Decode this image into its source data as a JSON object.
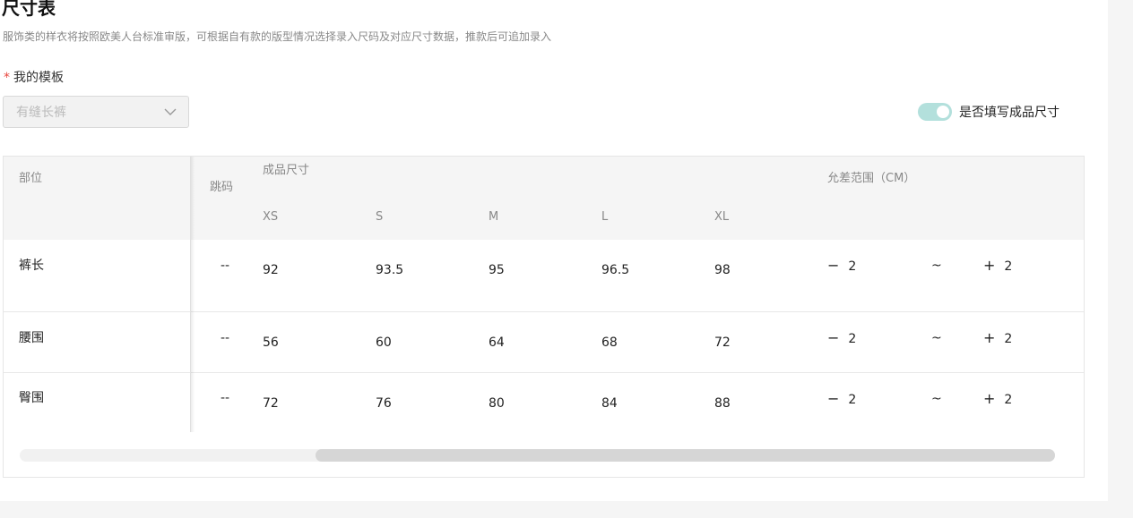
{
  "header": {
    "title": "尺寸表",
    "description": "服饰类的样衣将按照欧美人台标准审版，可根据自有款的版型情况选择录入尺码及对应尺寸数据，推款后可追加录入"
  },
  "template": {
    "required_mark": "*",
    "label": "我的模板",
    "selected": "有缝长裤"
  },
  "toggle": {
    "label": "是否填写成品尺寸",
    "on": true
  },
  "table": {
    "headers": {
      "part": "部位",
      "jump": "跳码",
      "finished_size": "成品尺寸",
      "tolerance": "允差范围（CM）",
      "sizes": [
        "XS",
        "S",
        "M",
        "L",
        "XL"
      ]
    },
    "rows": [
      {
        "part": "裤长",
        "jump": "--",
        "values": [
          "92",
          "93.5",
          "95",
          "96.5",
          "98"
        ],
        "minus": "2",
        "sep": "~",
        "plus": "2"
      },
      {
        "part": "腰围",
        "jump": "--",
        "values": [
          "56",
          "60",
          "64",
          "68",
          "72"
        ],
        "minus": "2",
        "sep": "~",
        "plus": "2"
      },
      {
        "part": "臀围",
        "jump": "--",
        "values": [
          "72",
          "76",
          "80",
          "84",
          "88"
        ],
        "minus": "2",
        "sep": "~",
        "plus": "2"
      }
    ]
  },
  "colors": {
    "toggle_on": "#b3e0dc",
    "required": "#e8453c",
    "header_bg": "#f5f5f5"
  }
}
